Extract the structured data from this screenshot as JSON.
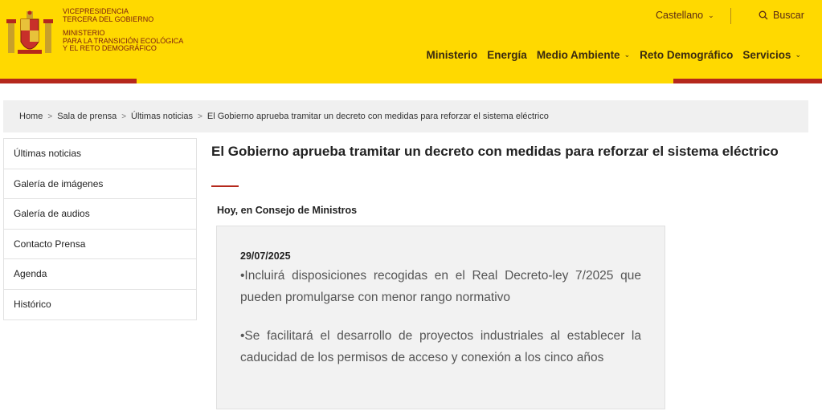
{
  "header": {
    "org_lines_1": [
      "VICEPRESIDENCIA",
      "TERCERA DEL GOBIERNO"
    ],
    "org_lines_2": [
      "MINISTERIO",
      "PARA LA TRANSICIÓN ECOLÓGICA",
      "Y EL RETO DEMOGRÁFICO"
    ],
    "language": "Castellano",
    "search_label": "Buscar",
    "nav": [
      {
        "label": "Ministerio",
        "dropdown": false
      },
      {
        "label": "Energía",
        "dropdown": false
      },
      {
        "label": "Medio Ambiente",
        "dropdown": true
      },
      {
        "label": "Reto Demográfico",
        "dropdown": false
      },
      {
        "label": "Servicios",
        "dropdown": true
      }
    ],
    "colors": {
      "brand_yellow": "#ffd900",
      "accent_red": "#b5281c"
    }
  },
  "breadcrumb": [
    "Home",
    "Sala de prensa",
    "Últimas noticias",
    "El Gobierno aprueba tramitar un decreto con medidas para reforzar el sistema eléctrico"
  ],
  "sidebar": {
    "items": [
      "Últimas noticias",
      "Galería de imágenes",
      "Galería de audios",
      "Contacto Prensa",
      "Agenda",
      "Histórico"
    ]
  },
  "article": {
    "title": "El Gobierno aprueba tramitar un decreto con medidas para reforzar el sistema eléctrico",
    "subtitle": "Hoy, en Consejo de Ministros",
    "date": "29/07/2025",
    "bullets": [
      "•Incluirá disposiciones recogidas en el Real Decreto-ley 7/2025 que pueden promulgarse con menor rango normativo",
      "•Se facilitará el desarrollo de proyectos industriales al establecer la caducidad de los permisos de acceso y conexión a los cinco años"
    ]
  }
}
